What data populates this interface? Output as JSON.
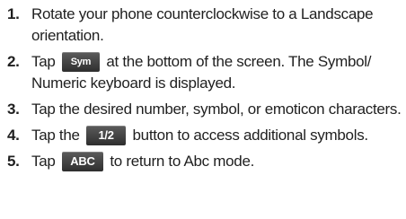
{
  "steps": [
    {
      "number": "1.",
      "text": "Rotate your phone counterclockwise to a Landscape orientation."
    },
    {
      "number": "2.",
      "before": "Tap",
      "key": "Sym",
      "after": "at the bottom of the screen. The Symbol/ Numeric keyboard is displayed."
    },
    {
      "number": "3.",
      "text": "Tap the desired number, symbol, or emoticon characters."
    },
    {
      "number": "4.",
      "before": "Tap the",
      "key": "1/2",
      "after": "button to access additional symbols."
    },
    {
      "number": "5.",
      "before": "Tap",
      "key": "ABC",
      "after": "to return to Abc mode."
    }
  ]
}
